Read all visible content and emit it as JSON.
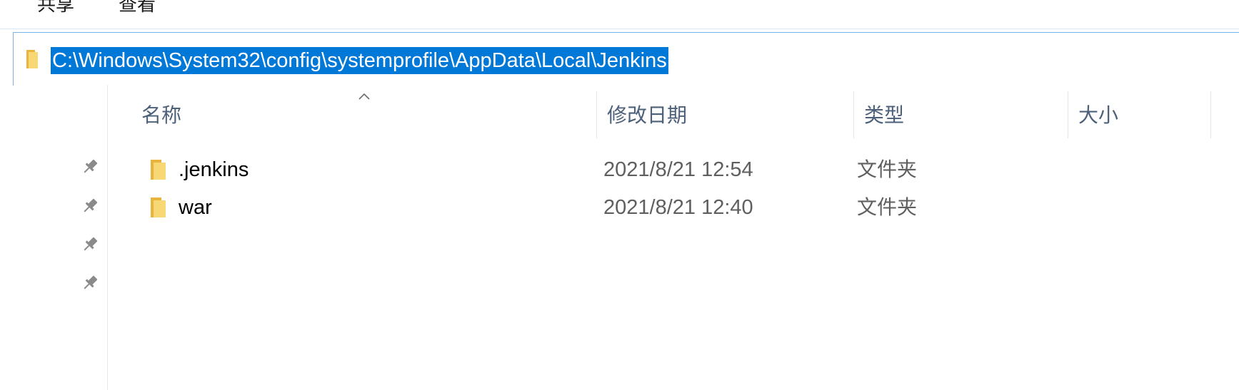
{
  "ribbon": {
    "tabs": [
      "共享",
      "查看"
    ]
  },
  "address_bar": {
    "path": "C:\\Windows\\System32\\config\\systemprofile\\AppData\\Local\\Jenkins",
    "icon": "folder-icon"
  },
  "columns": [
    "名称",
    "修改日期",
    "类型",
    "大小"
  ],
  "sort": {
    "column": "名称",
    "direction": "ascending"
  },
  "files": [
    {
      "name": ".jenkins",
      "modified": "2021/8/21 12:54",
      "type": "文件夹",
      "size": "",
      "icon": "folder-icon"
    },
    {
      "name": "war",
      "modified": "2021/8/21 12:40",
      "type": "文件夹",
      "size": "",
      "icon": "folder-icon"
    }
  ],
  "quick_access_pins": 4,
  "colors": {
    "selection": "#0078d7",
    "header_text": "#4c607a",
    "folder": "#f8d775"
  }
}
